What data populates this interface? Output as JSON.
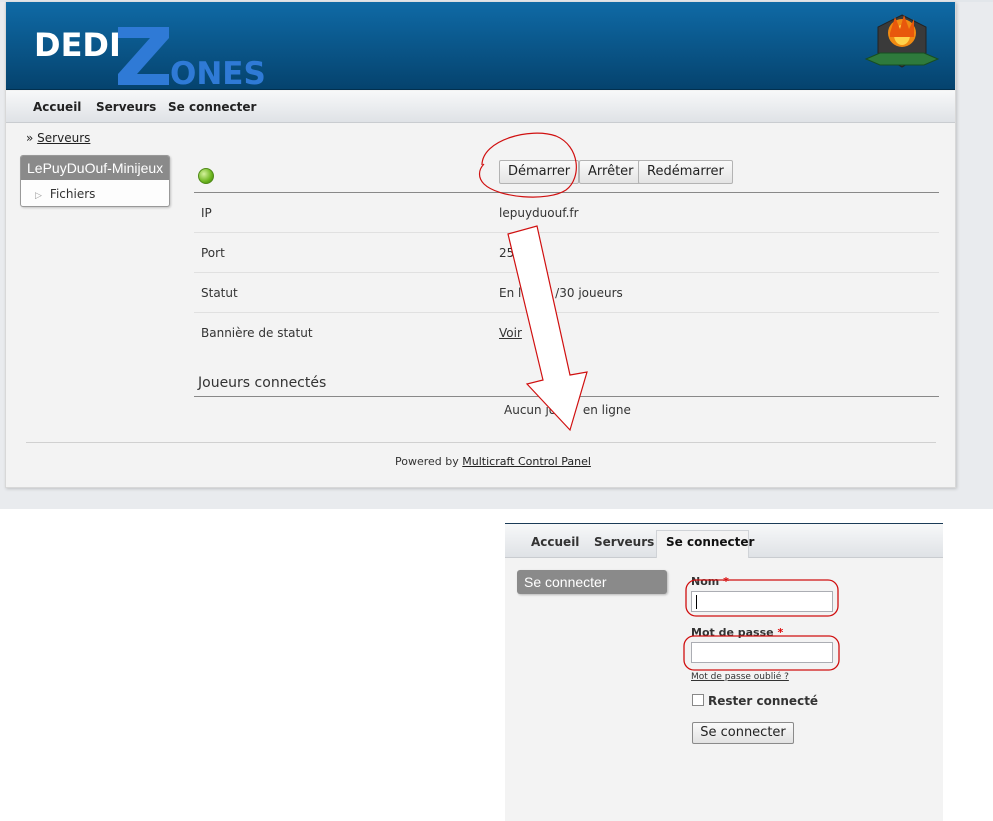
{
  "colors": {
    "header_bg": "#05436e",
    "logo_text": "#ffffff",
    "logo_z": "#2f7ad6",
    "annotation_red": "#d01010",
    "status_green": "#6cb51e",
    "required_star": "#dd0000"
  },
  "brand": {
    "logo_left": "DEDI",
    "logo_z": "Z",
    "logo_right": "ONES",
    "emblem_icon": "fire-shield-emblem-icon"
  },
  "nav": {
    "items": [
      "Accueil",
      "Serveurs",
      "Se connecter"
    ]
  },
  "breadcrumb": {
    "prefix": "»",
    "link": "Serveurs"
  },
  "sidebar": {
    "server_name": "LePuyDuOuf-Minijeux",
    "item_icon": "triangle-right-icon",
    "item": "Fichiers"
  },
  "server": {
    "status": "online",
    "status_icon": "green-dot-icon",
    "buttons": {
      "start": "Démarrer",
      "stop": "Arrêter",
      "restart": "Redémarrer"
    },
    "rows": [
      {
        "key": "IP",
        "value": "lepuyduouf.fr"
      },
      {
        "key": "Port",
        "value": "25"
      },
      {
        "key": "Statut",
        "value": "En li        /30 joueurs"
      },
      {
        "key": "Bannière de statut",
        "value": "Voir"
      }
    ],
    "players_title": "Joueurs connectés",
    "players_empty": "Aucun jo       en ligne"
  },
  "footer": {
    "prefix": "Powered by",
    "link": "Multicraft Control Panel"
  },
  "login": {
    "nav": [
      "Accueil",
      "Serveurs",
      "Se connecter"
    ],
    "active_tab": "Se connecter",
    "side_title": "Se connecter",
    "name_label": "Nom",
    "password_label": "Mot de passe",
    "required_mark": "*",
    "name_value": "",
    "password_value": "",
    "forgot": "Mot de passe oublié ?",
    "remember_label": "Rester connecté",
    "remember_checked": false,
    "submit": "Se connecter"
  }
}
